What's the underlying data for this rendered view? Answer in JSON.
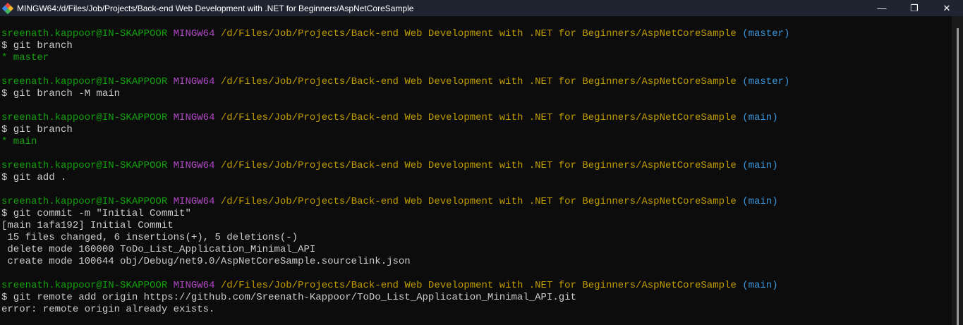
{
  "window": {
    "title": "MINGW64:/d/Files/Job/Projects/Back-end Web Development with .NET for Beginners/AspNetCoreSample",
    "minimize": "—",
    "maximize": "❐",
    "close": "✕"
  },
  "prompt": {
    "user": "sreenath.kappoor@IN-SKAPPOOR",
    "env": "MINGW64",
    "path": "/d/Files/Job/Projects/Back-end Web Development with .NET for Beginners/AspNetCoreSample"
  },
  "blocks": [
    {
      "branch": "(master)",
      "cmd": "$ git branch",
      "out": [
        {
          "t": "* master",
          "c": "g"
        }
      ]
    },
    {
      "branch": "(master)",
      "cmd": "$ git branch -M main",
      "out": []
    },
    {
      "branch": "(main)",
      "cmd": "$ git branch",
      "out": [
        {
          "t": "* main",
          "c": "g"
        }
      ]
    },
    {
      "branch": "(main)",
      "cmd": "$ git add .",
      "out": []
    },
    {
      "branch": "(main)",
      "cmd": "$ git commit -m \"Initial Commit\"",
      "out": [
        {
          "t": "[main 1afa192] Initial Commit"
        },
        {
          "t": " 15 files changed, 6 insertions(+), 5 deletions(-)"
        },
        {
          "t": " delete mode 160000 ToDo_List_Application_Minimal_API"
        },
        {
          "t": " create mode 100644 obj/Debug/net9.0/AspNetCoreSample.sourcelink.json"
        }
      ]
    },
    {
      "branch": "(main)",
      "cmd": "$ git remote add origin https://github.com/Sreenath-Kappoor/ToDo_List_Application_Minimal_API.git",
      "out": [
        {
          "t": "error: remote origin already exists."
        }
      ]
    }
  ]
}
